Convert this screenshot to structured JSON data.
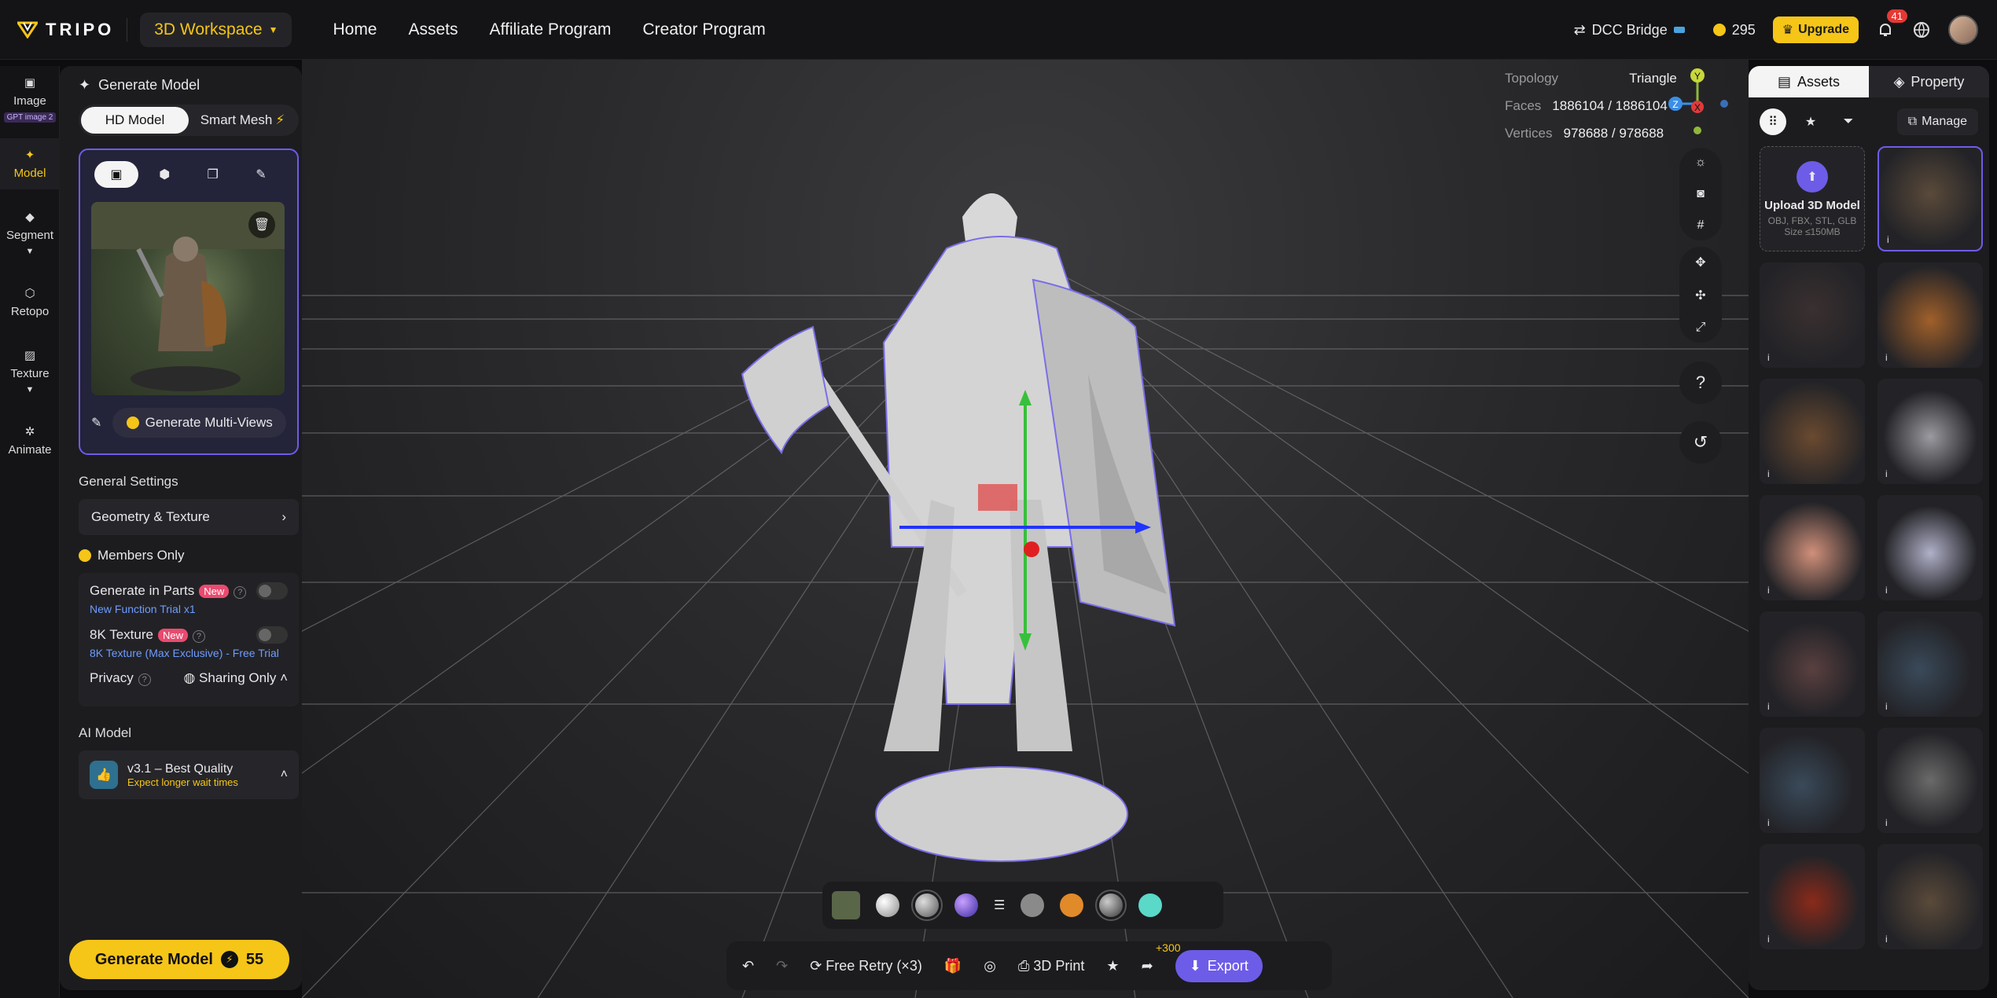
{
  "topbar": {
    "logo": "TRIPO",
    "workspace": "3D Workspace",
    "nav": [
      "Home",
      "Assets",
      "Affiliate Program",
      "Creator Program"
    ],
    "dcc": "DCC Bridge",
    "credits": "295",
    "upgrade": "Upgrade",
    "notifications": "41"
  },
  "rail": [
    {
      "label": "Image",
      "tag": "GPT image 2"
    },
    {
      "label": "Model"
    },
    {
      "label": "Segment"
    },
    {
      "label": "Retopo"
    },
    {
      "label": "Texture"
    },
    {
      "label": "Animate"
    }
  ],
  "left": {
    "title": "Generate Model",
    "modes": [
      "HD Model",
      "Smart Mesh"
    ],
    "multi_views": "Generate Multi-Views",
    "general_settings": "General Settings",
    "geometry_texture": "Geometry & Texture",
    "members_only": "Members Only",
    "parts_label": "Generate in Parts",
    "new_tag": "New",
    "parts_note": "New Function Trial x1",
    "texture8k_label": "8K Texture",
    "texture8k_note": "8K Texture (Max Exclusive) - Free Trial",
    "privacy_label": "Privacy",
    "privacy_value": "Sharing Only",
    "ai_model_title": "AI Model",
    "ai_model_name": "v3.1 – Best Quality",
    "ai_model_note": "Expect longer wait times",
    "generate_button": "Generate Model",
    "generate_cost": "55"
  },
  "viewport": {
    "topology_label": "Topology",
    "topology_value": "Triangle",
    "faces_label": "Faces",
    "faces_value": "1886104 / 1886104",
    "vertices_label": "Vertices",
    "vertices_value": "978688 / 978688",
    "gizmo": {
      "y": "Y",
      "z": "Z",
      "x": "X"
    },
    "help": "?",
    "free_retry": "Free Retry (×3)",
    "print": "3D Print",
    "export": "Export",
    "plus300": "+300"
  },
  "right": {
    "tabs": [
      "Assets",
      "Property"
    ],
    "manage": "Manage",
    "upload_title": "Upload 3D Model",
    "upload_formats": "OBJ, FBX, STL, GLB",
    "upload_size": "Size ≤150MB"
  },
  "colors": {
    "accent": "#f5c518",
    "purple": "#6d5ce8",
    "bg": "#0d0d0f"
  }
}
